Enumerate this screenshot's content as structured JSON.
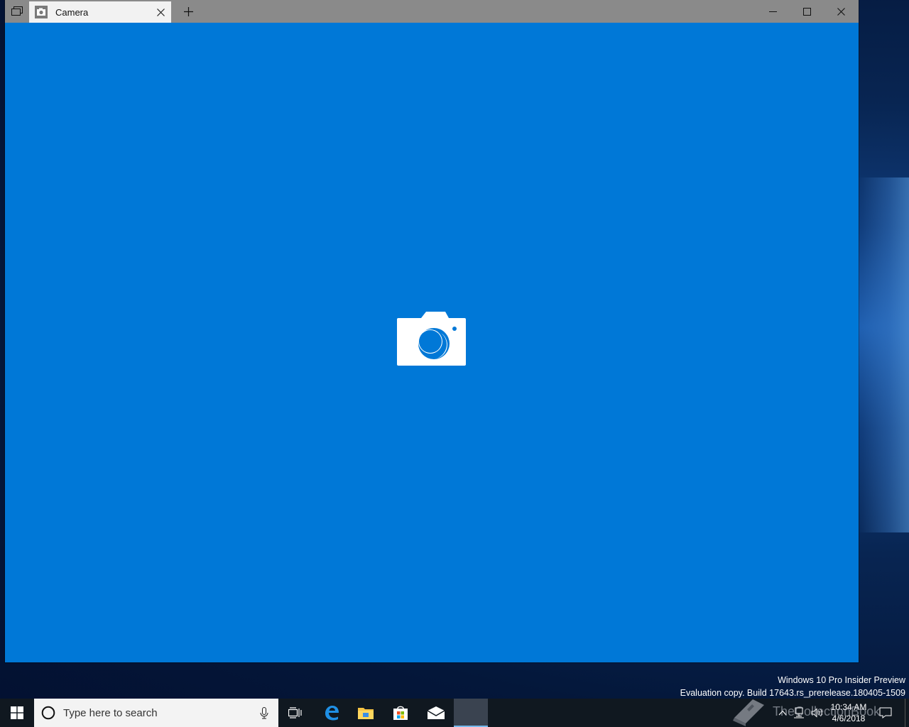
{
  "window": {
    "tab_title": "Camera",
    "accent_color": "#0078d7"
  },
  "taskbar": {
    "search_placeholder": "Type here to search",
    "clock_time": "10:34 AM",
    "clock_date": "4/6/2018",
    "apps": [
      "task-view-icon",
      "edge-icon",
      "file-explorer-icon",
      "store-icon",
      "mail-icon",
      "camera-app-icon"
    ]
  },
  "watermark": {
    "line1": "Windows 10 Pro Insider Preview",
    "line2": "Evaluation copy. Build 17643.rs_prerelease.180405-1509"
  },
  "logo_watermark": {
    "text": "TheCollectionBook"
  }
}
